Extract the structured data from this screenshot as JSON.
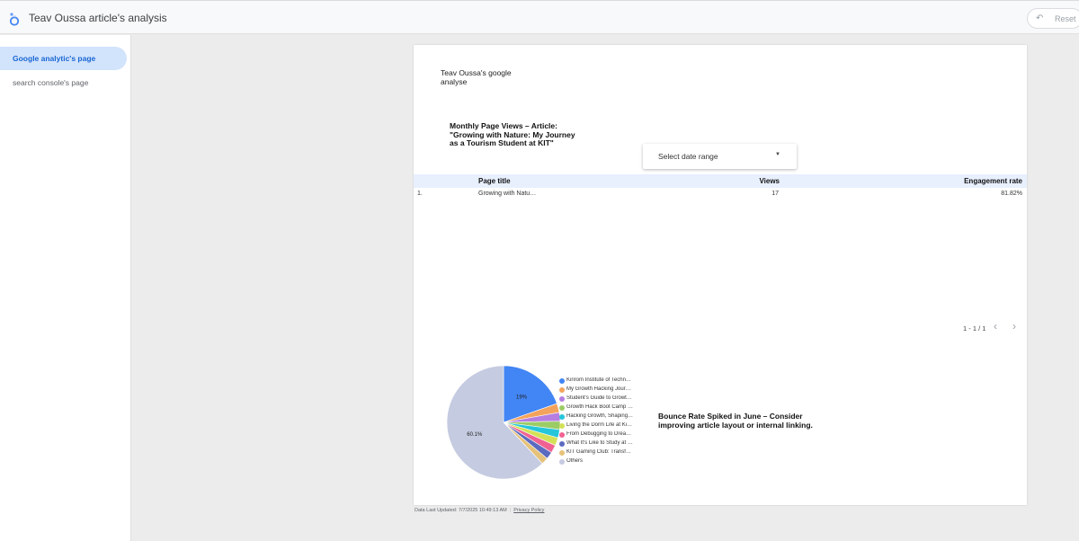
{
  "header": {
    "title": "Teav Oussa article's analysis",
    "reset_label": "Reset",
    "reset_icon": "undo-icon",
    "logo_icon": "looker-studio-logo"
  },
  "sidebar": {
    "items": [
      {
        "label": "Google analytic's page",
        "active": true
      },
      {
        "label": "search console's page",
        "active": false
      }
    ]
  },
  "report": {
    "title": "Teav Oussa's google analyse",
    "section_title": "Monthly Page Views – Article: \"Growing with Nature: My Journey as a Tourism Student at KIT\"",
    "date_range_label": "Select date range",
    "table": {
      "columns": [
        "Page title",
        "Views",
        "Engagement rate"
      ],
      "rows": [
        {
          "index": "1.",
          "page_title": "Growing with Natu…",
          "views": "17",
          "engagement_rate": "81.82%"
        }
      ],
      "pager": "1 - 1 / 1"
    },
    "insight": "Bounce Rate Spiked in June – Consider improving article layout or internal linking."
  },
  "chart_data": {
    "type": "pie",
    "slices": [
      {
        "label": "Kirirom Institute of Techn…",
        "value": 19,
        "color": "#4285f4",
        "shown_label": "19%"
      },
      {
        "label": "My Growth Hacking Jour…",
        "value": 2.5,
        "color": "#f4a35c",
        "shown_label": ""
      },
      {
        "label": "Student's Guide to Growt…",
        "value": 2.4,
        "color": "#b57ee0",
        "shown_label": ""
      },
      {
        "label": "Growth Hack Boot Camp …",
        "value": 2.3,
        "color": "#9ccc65",
        "shown_label": ""
      },
      {
        "label": "Hacking Growth, Shaping…",
        "value": 2.3,
        "color": "#26c6da",
        "shown_label": ""
      },
      {
        "label": "Living the Dorm Life at Ki…",
        "value": 2.2,
        "color": "#d4e157",
        "shown_label": ""
      },
      {
        "label": "From Debugging to Drea…",
        "value": 2.2,
        "color": "#f06292",
        "shown_label": ""
      },
      {
        "label": "What It's Like to Study at …",
        "value": 2.0,
        "color": "#5c6bc0",
        "shown_label": ""
      },
      {
        "label": "KIT Gaming Club: Transf…",
        "value": 1.9,
        "color": "#e6c27a",
        "shown_label": ""
      },
      {
        "label": "Others",
        "value": 60.1,
        "color": "#c5cbe0",
        "shown_label": "60.1%"
      }
    ]
  },
  "footer": {
    "updated": "Data Last Updated: 7/7/2025 10:49:13 AM",
    "privacy": "Privacy Policy"
  }
}
